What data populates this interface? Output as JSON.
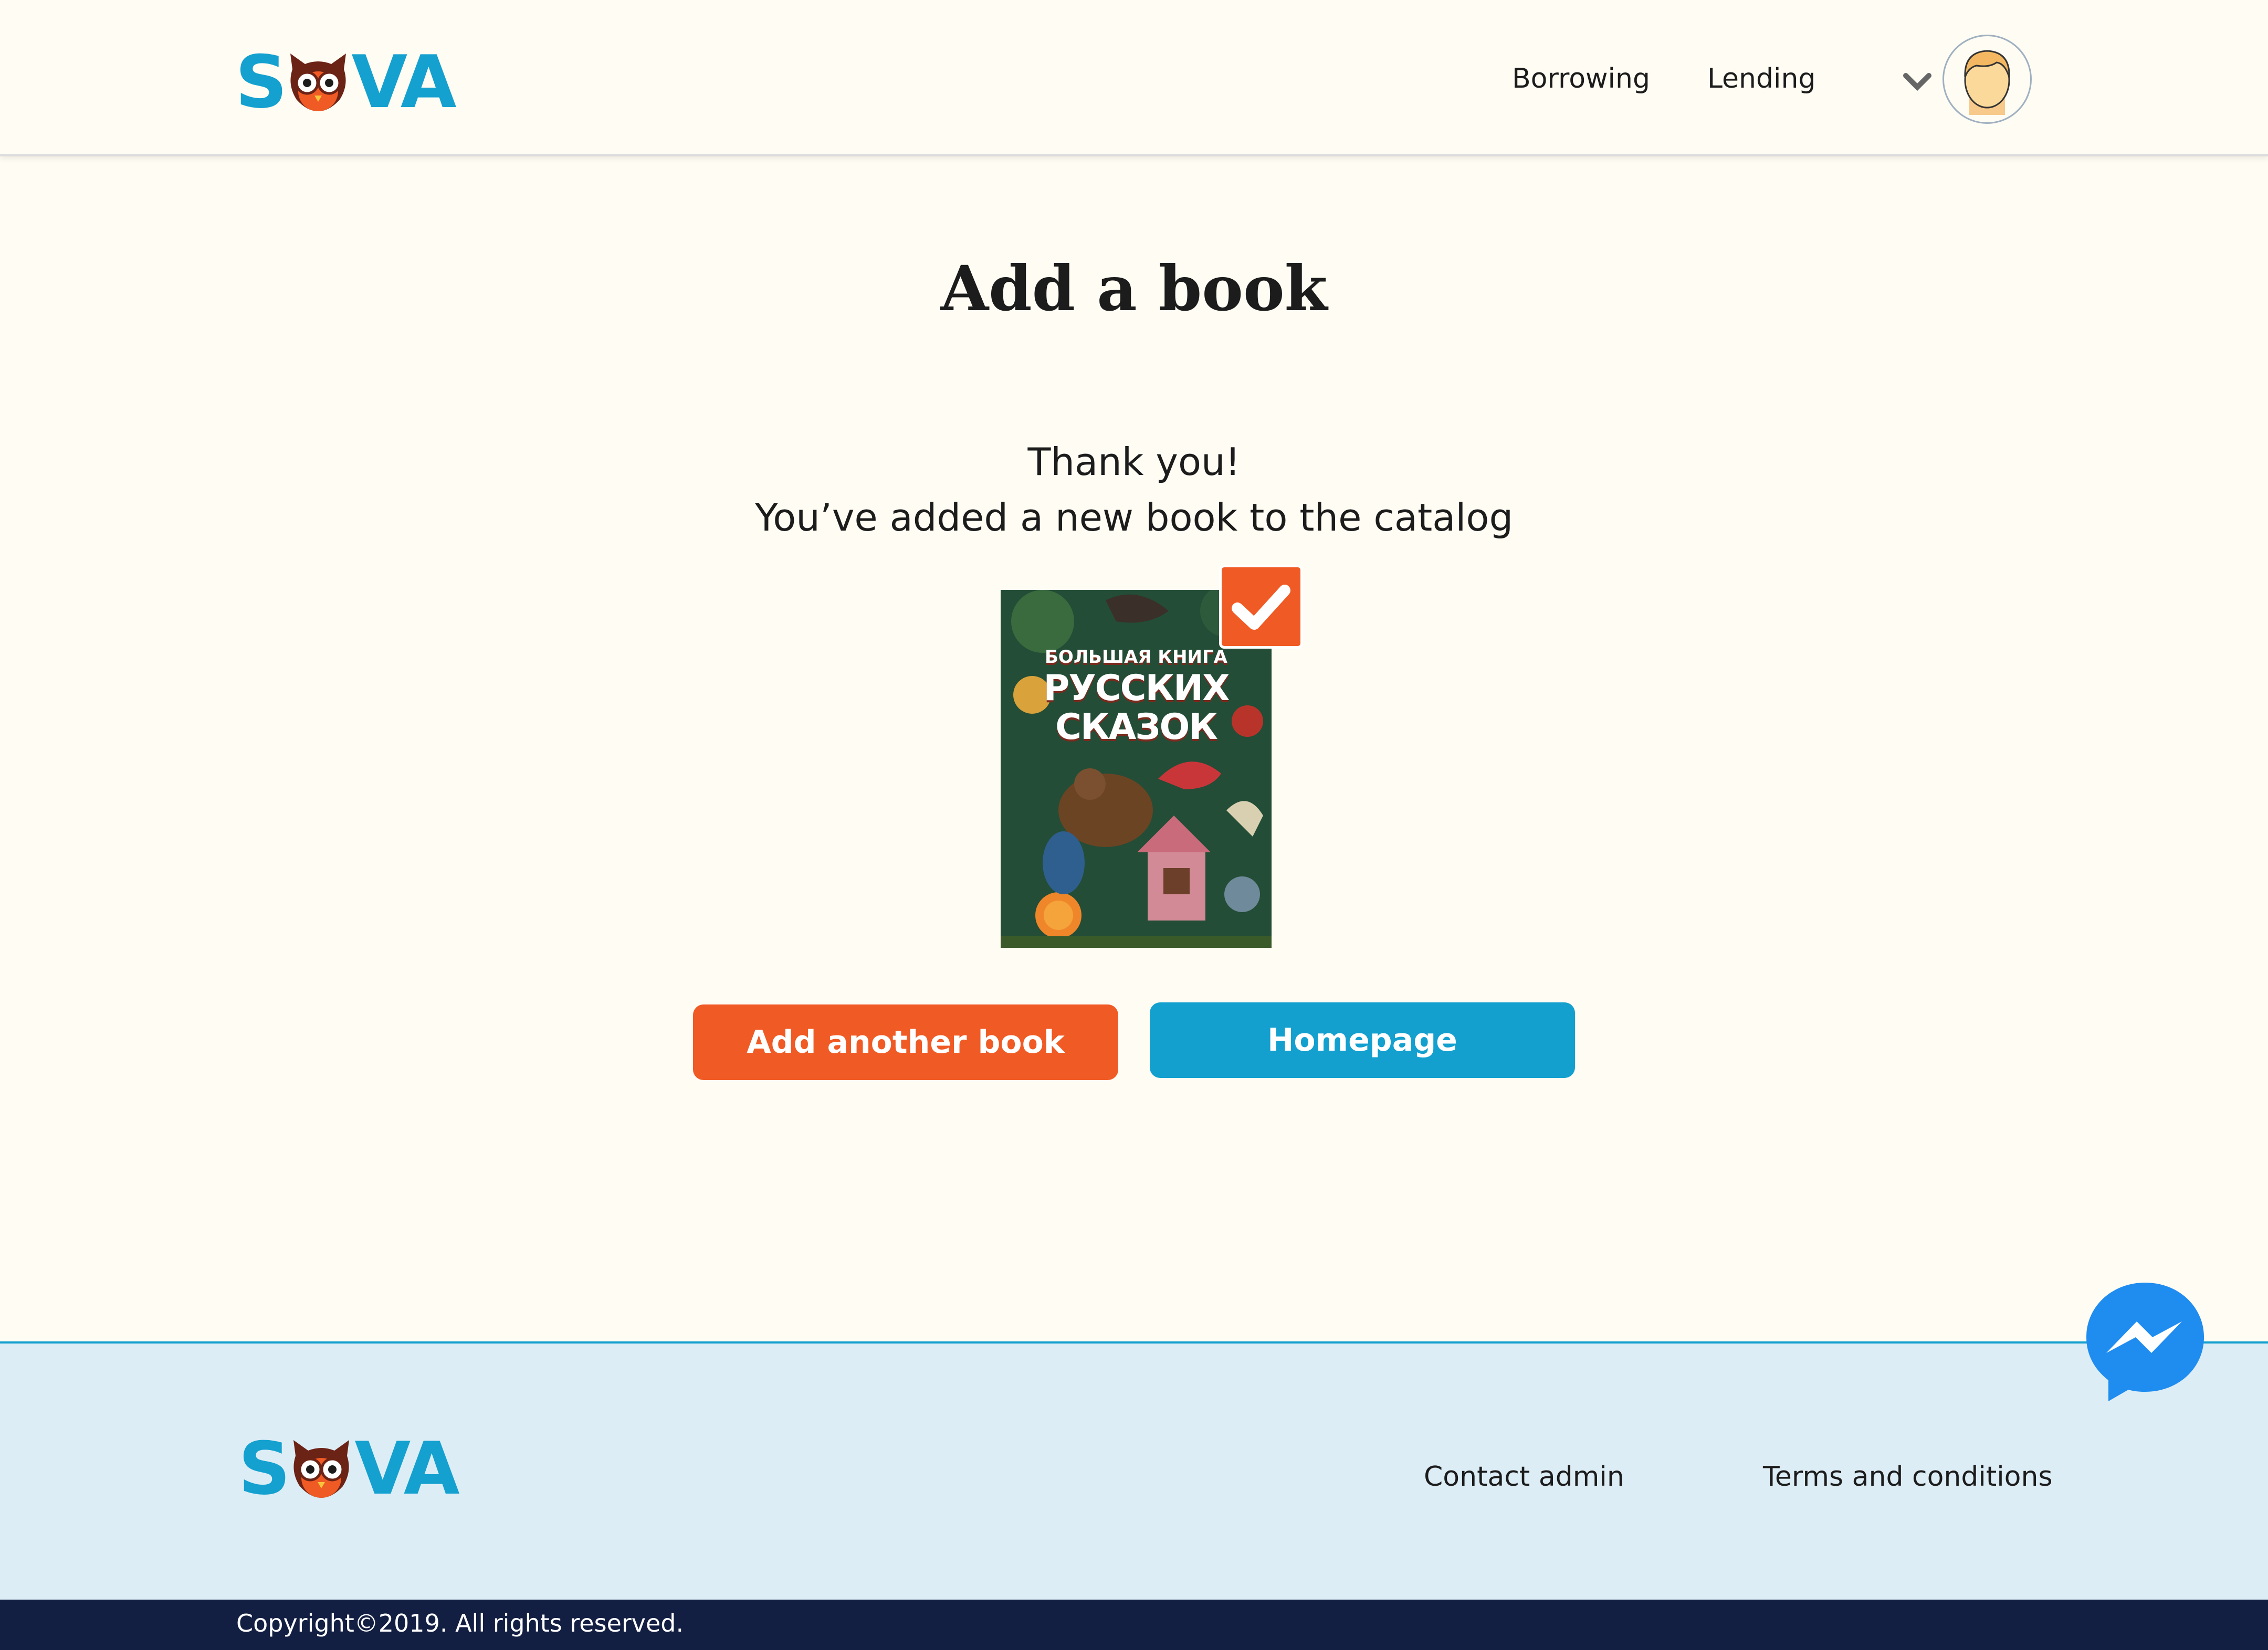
{
  "brand": {
    "logo_left": "S",
    "logo_right": "VA",
    "logo_text": "SOVA",
    "primary_color": "#13a0cf",
    "accent_color": "#f05a24"
  },
  "header": {
    "nav": [
      {
        "label": "Borrowing"
      },
      {
        "label": "Lending"
      }
    ],
    "menu_icon": "chevron-down-icon",
    "avatar_icon": "user-avatar-icon"
  },
  "main": {
    "title": "Add a book",
    "message_line1": "Thank you!",
    "message_line2": "You’ve added a new book to the catalog",
    "book": {
      "cover_line1": "БОЛЬШАЯ КНИГА",
      "cover_line2": "РУССКИХ",
      "cover_line3": "СКАЗОК",
      "status_icon": "checkmark-icon"
    },
    "buttons": {
      "add_another": "Add another book",
      "homepage": "Homepage"
    }
  },
  "footer": {
    "links": [
      {
        "label": "Contact admin"
      },
      {
        "label": "Terms and conditions"
      }
    ],
    "copyright": "Copyright©2019. All rights reserved."
  },
  "chat": {
    "icon": "messenger-icon"
  }
}
